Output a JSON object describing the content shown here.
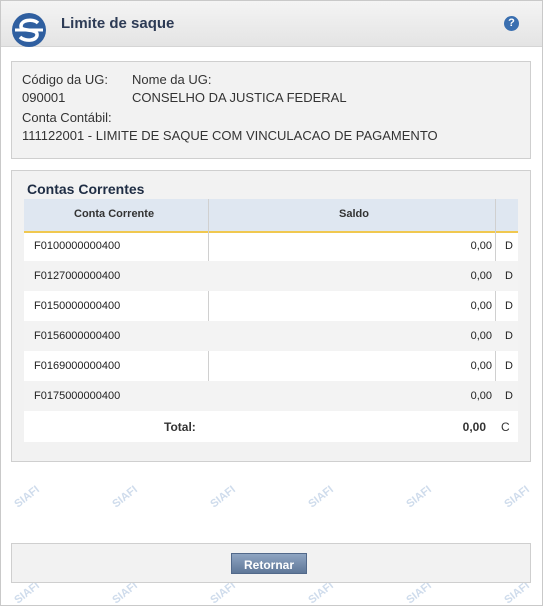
{
  "header": {
    "title": "Limite de saque",
    "help_glyph": "?",
    "logo_icon": "siafi-logo-icon",
    "help_icon": "help-icon"
  },
  "info": {
    "ug_code_label": "Código da UG:",
    "ug_code_value": "090001",
    "ug_name_label": "Nome da UG:",
    "ug_name_value": "CONSELHO DA JUSTICA FEDERAL",
    "account_label": "Conta Contábil:",
    "account_value": "111122001 - LIMITE DE SAQUE COM VINCULACAO DE PAGAMENTO"
  },
  "accounts": {
    "title": "Contas Correntes",
    "columns": [
      "Conta Corrente",
      "Saldo"
    ],
    "rows": [
      {
        "conta": "F0100000000400",
        "saldo": "0,00",
        "dc": "D"
      },
      {
        "conta": "F0127000000400",
        "saldo": "0,00",
        "dc": "D"
      },
      {
        "conta": "F0150000000400",
        "saldo": "0,00",
        "dc": "D"
      },
      {
        "conta": "F0156000000400",
        "saldo": "0,00",
        "dc": "D"
      },
      {
        "conta": "F0169000000400",
        "saldo": "0,00",
        "dc": "D"
      },
      {
        "conta": "F0175000000400",
        "saldo": "0,00",
        "dc": "D"
      }
    ],
    "total_label": "Total:",
    "total_value": "0,00",
    "total_dc": "C"
  },
  "footer": {
    "return_label": "Retornar"
  },
  "watermark": "SIAFI",
  "colors": {
    "accent": "#3a6fb0",
    "header_row": "#dfe7f1",
    "header_underline": "#f0c850",
    "button": "#6a82a3"
  }
}
